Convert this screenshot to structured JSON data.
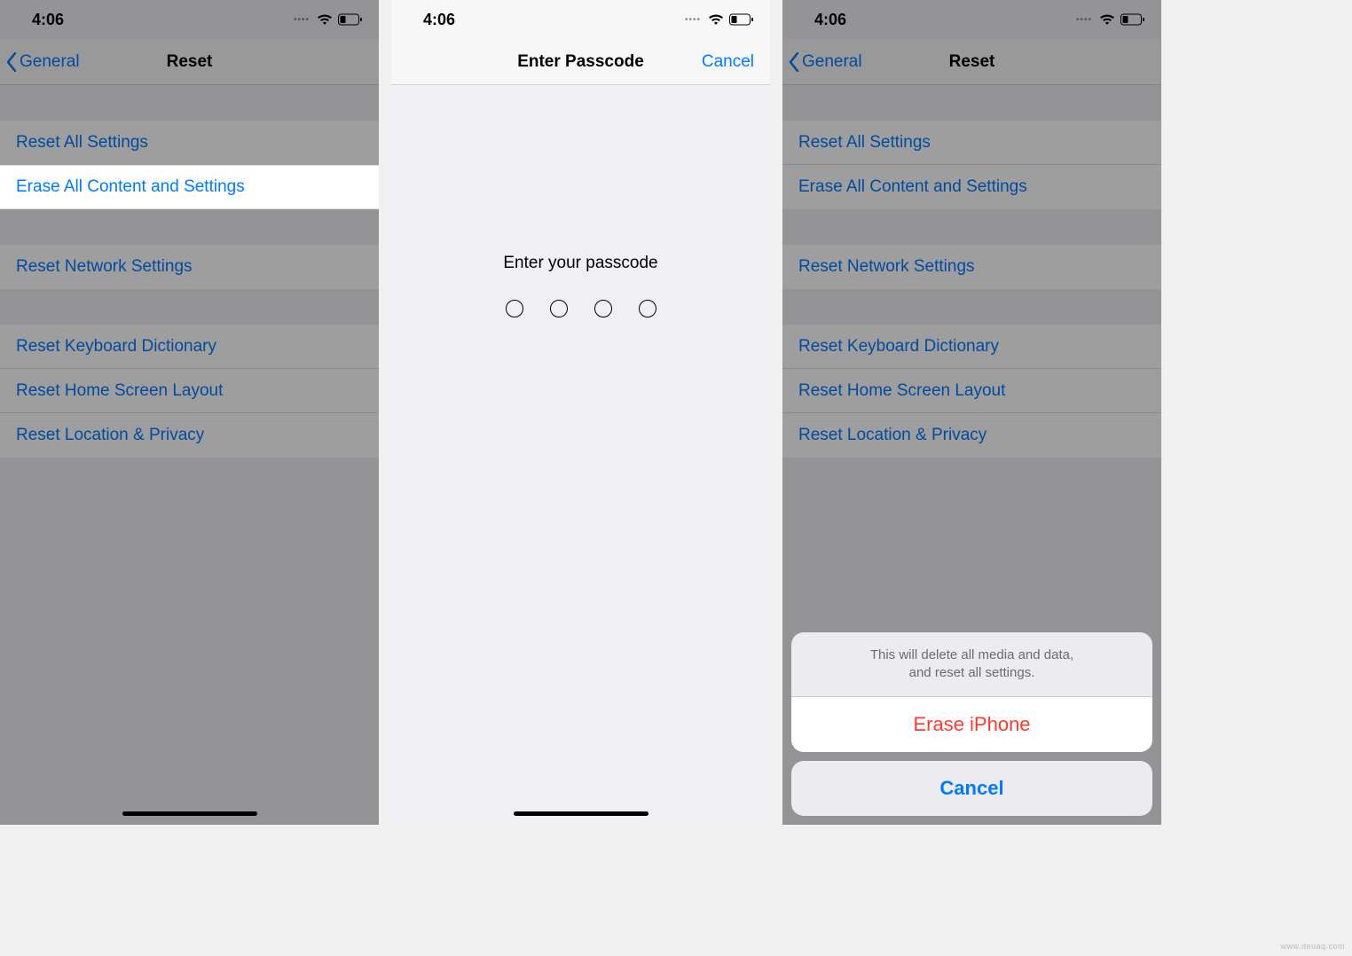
{
  "status": {
    "time": "4:06"
  },
  "nav": {
    "back_label": "General",
    "title": "Reset",
    "passcode_title": "Enter Passcode",
    "cancel": "Cancel"
  },
  "reset_options": {
    "reset_all": "Reset All Settings",
    "erase_all": "Erase All Content and Settings",
    "network": "Reset Network Settings",
    "keyboard": "Reset Keyboard Dictionary",
    "home_screen": "Reset Home Screen Layout",
    "location": "Reset Location & Privacy"
  },
  "passcode": {
    "prompt": "Enter your passcode"
  },
  "sheet": {
    "message_line1": "This will delete all media and data,",
    "message_line2": "and reset all settings.",
    "erase": "Erase iPhone",
    "cancel": "Cancel"
  },
  "watermark": "www.deuaq.com"
}
